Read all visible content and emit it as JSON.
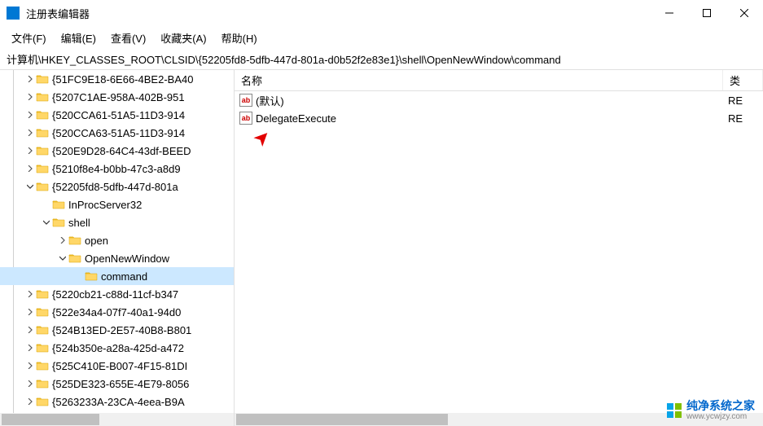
{
  "window": {
    "title": "注册表编辑器"
  },
  "menu": {
    "file": "文件(F)",
    "edit": "编辑(E)",
    "view": "查看(V)",
    "favorites": "收藏夹(A)",
    "help": "帮助(H)"
  },
  "address": {
    "path": "计算机\\HKEY_CLASSES_ROOT\\CLSID\\{52205fd8-5dfb-447d-801a-d0b52f2e83e1}\\shell\\OpenNewWindow\\command"
  },
  "tree": {
    "items": [
      {
        "indent": 1,
        "expander": "chevron-right",
        "label": "{51FC9E18-6E66-4BE2-BA40"
      },
      {
        "indent": 1,
        "expander": "chevron-right",
        "label": "{5207C1AE-958A-402B-951"
      },
      {
        "indent": 1,
        "expander": "chevron-right",
        "label": "{520CCA61-51A5-11D3-914"
      },
      {
        "indent": 1,
        "expander": "chevron-right",
        "label": "{520CCA63-51A5-11D3-914"
      },
      {
        "indent": 1,
        "expander": "chevron-right",
        "label": "{520E9D28-64C4-43df-BEED"
      },
      {
        "indent": 1,
        "expander": "chevron-right",
        "label": "{5210f8e4-b0bb-47c3-a8d9"
      },
      {
        "indent": 1,
        "expander": "chevron-down",
        "label": "{52205fd8-5dfb-447d-801a"
      },
      {
        "indent": 2,
        "expander": "",
        "label": "InProcServer32"
      },
      {
        "indent": 2,
        "expander": "chevron-down",
        "label": "shell"
      },
      {
        "indent": 3,
        "expander": "chevron-right",
        "label": "open"
      },
      {
        "indent": 3,
        "expander": "chevron-down",
        "label": "OpenNewWindow"
      },
      {
        "indent": 4,
        "expander": "",
        "label": "command",
        "selected": true
      },
      {
        "indent": 1,
        "expander": "chevron-right",
        "label": "{5220cb21-c88d-11cf-b347"
      },
      {
        "indent": 1,
        "expander": "chevron-right",
        "label": "{522e34a4-07f7-40a1-94d0"
      },
      {
        "indent": 1,
        "expander": "chevron-right",
        "label": "{524B13ED-2E57-40B8-B801"
      },
      {
        "indent": 1,
        "expander": "chevron-right",
        "label": "{524b350e-a28a-425d-a472"
      },
      {
        "indent": 1,
        "expander": "chevron-right",
        "label": "{525C410E-B007-4F15-81DI"
      },
      {
        "indent": 1,
        "expander": "chevron-right",
        "label": "{525DE323-655E-4E79-8056"
      },
      {
        "indent": 1,
        "expander": "chevron-right",
        "label": "{5263233A-23CA-4eea-B9A"
      }
    ]
  },
  "list": {
    "header_name": "名称",
    "header_type": "类",
    "rows": [
      {
        "name": "(默认)",
        "type": "RE"
      },
      {
        "name": "DelegateExecute",
        "type": "RE"
      }
    ]
  },
  "watermark": {
    "title": "纯净系统之家",
    "url": "www.ycwjzy.com"
  }
}
